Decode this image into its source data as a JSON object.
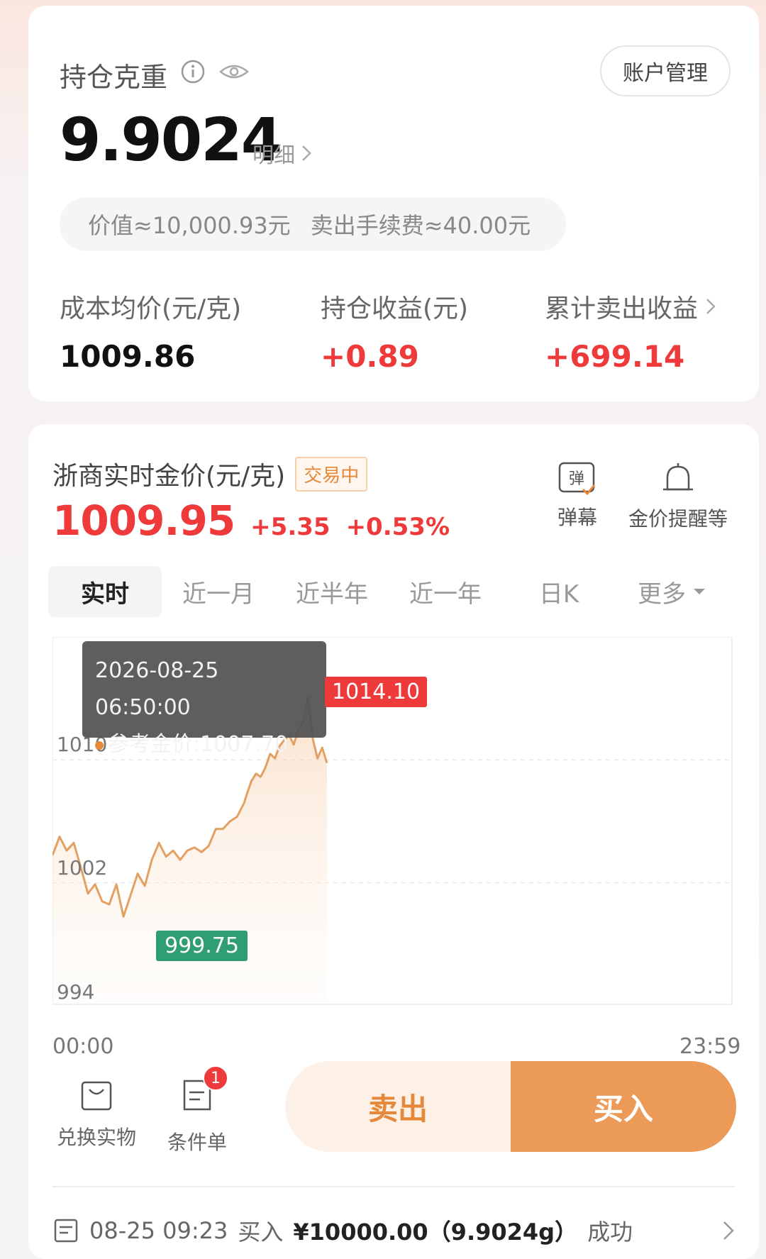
{
  "holdings": {
    "title": "持仓克重",
    "account_btn": "账户管理",
    "grams": "9.9024",
    "detail_label": "明细",
    "value_text": "价值≈10,000.93元",
    "fee_text": "卖出手续费≈40.00元",
    "stats": [
      {
        "label": "成本均价(元/克)",
        "value": "1009.86"
      },
      {
        "label": "持仓收益(元)",
        "value": "+0.89"
      },
      {
        "label": "累计卖出收益",
        "value": "+699.14"
      }
    ]
  },
  "price": {
    "title": "浙商实时金价(元/克)",
    "status_badge": "交易中",
    "current": "1009.95",
    "change": "+5.35",
    "change_pct": "+0.53%",
    "tools": {
      "danmu_icon_char": "弹",
      "danmu": "弹幕",
      "alert": "金价提醒等"
    },
    "tabs": [
      "实时",
      "近一月",
      "近半年",
      "近一年",
      "日K",
      "更多"
    ],
    "tooltip_time": "2026-08-25 06:50:00",
    "tooltip_value": "参考金价:1007.70",
    "high_label": "1014.10",
    "low_label": "999.75",
    "y_ticks": [
      "1010",
      "1002",
      "994"
    ],
    "x_ticks": [
      "00:00",
      "23:59"
    ]
  },
  "chart_data": {
    "type": "line",
    "title": "",
    "xlabel": "",
    "ylabel": "",
    "xlim": [
      "00:00",
      "23:59"
    ],
    "ylim": [
      994,
      1018
    ],
    "x": [
      "00:00",
      "00:15",
      "00:30",
      "00:45",
      "01:00",
      "01:15",
      "01:30",
      "01:45",
      "02:00",
      "02:15",
      "02:30",
      "02:45",
      "03:00",
      "03:15",
      "03:30",
      "03:45",
      "04:00",
      "04:15",
      "04:30",
      "04:45",
      "05:00",
      "05:15",
      "05:30",
      "05:45",
      "06:00",
      "06:15",
      "06:30",
      "06:45",
      "06:50",
      "07:00",
      "07:10",
      "07:20",
      "07:30",
      "07:40",
      "07:50",
      "08:00",
      "08:10",
      "08:20",
      "08:30",
      "08:40",
      "08:50",
      "09:00",
      "09:10",
      "09:20",
      "09:30",
      "09:40"
    ],
    "series": [
      {
        "values": [
          1003.8,
          1005.0,
          1004.1,
          1004.6,
          1003.0,
          1001.3,
          1001.9,
          1000.8,
          1000.6,
          1001.9,
          999.8,
          1001.2,
          1002.6,
          1001.8,
          1003.5,
          1004.6,
          1003.7,
          1004.1,
          1003.5,
          1004.1,
          1004.3,
          1004.0,
          1004.4,
          1005.5,
          1005.5,
          1006.0,
          1006.3,
          1007.2,
          1007.7,
          1008.6,
          1009.1,
          1008.9,
          1009.5,
          1010.4,
          1010.1,
          1010.9,
          1011.3,
          1011.6,
          1011.0,
          1012.0,
          1012.5,
          1014.1,
          1011.4,
          1010.1,
          1010.8,
          1009.8
        ]
      }
    ],
    "annotations": [
      {
        "label": "1014.10",
        "kind": "high"
      },
      {
        "label": "999.75",
        "kind": "low"
      }
    ]
  },
  "actions": {
    "redeem": "兑换实物",
    "conditional": "条件单",
    "conditional_badge": "1",
    "sell": "卖出",
    "buy": "买入"
  },
  "order": {
    "time": "08-25 09:23",
    "type": "买入",
    "amount": "¥10000.00（9.9024g）",
    "status": "成功"
  },
  "colors": {
    "accent": "#e6883a",
    "up_red": "#ee3a3a",
    "low_green": "#2f9e73",
    "line": "#e3a063"
  }
}
